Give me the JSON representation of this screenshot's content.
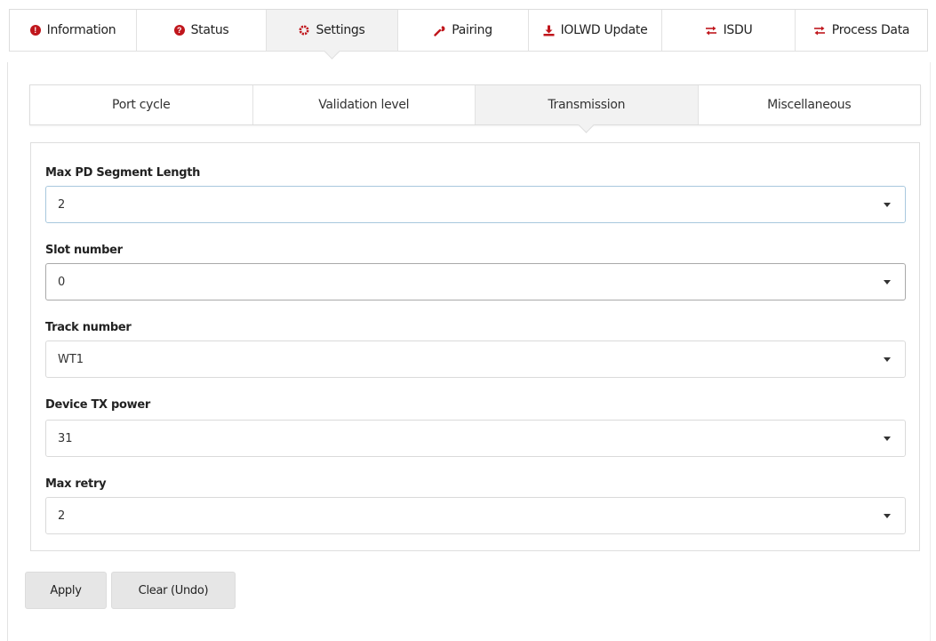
{
  "top_tabs": [
    {
      "label": "Information",
      "icon": "info-circle-icon",
      "active": false
    },
    {
      "label": "Status",
      "icon": "question-circle-icon",
      "active": false
    },
    {
      "label": "Settings",
      "icon": "gear-icon",
      "active": true
    },
    {
      "label": "Pairing",
      "icon": "wrench-icon",
      "active": false
    },
    {
      "label": "IOLWD Update",
      "icon": "download-icon",
      "active": false
    },
    {
      "label": "ISDU",
      "icon": "exchange-icon",
      "active": false
    },
    {
      "label": "Process Data",
      "icon": "exchange-icon",
      "active": false
    }
  ],
  "sub_tabs": [
    {
      "label": "Port cycle",
      "active": false
    },
    {
      "label": "Validation level",
      "active": false
    },
    {
      "label": "Transmission",
      "active": true
    },
    {
      "label": "Miscellaneous",
      "active": false
    }
  ],
  "fields": [
    {
      "label": "Max PD Segment Length",
      "value": "2"
    },
    {
      "label": "Slot number",
      "value": "0"
    },
    {
      "label": "Track number",
      "value": "WT1"
    },
    {
      "label": "Device TX power",
      "value": "31"
    },
    {
      "label": "Max retry",
      "value": "2"
    }
  ],
  "buttons": {
    "apply": "Apply",
    "clear": "Clear (Undo)"
  },
  "colors": {
    "icon_red": "#c0161c",
    "active_tab_bg": "#f2f2f2",
    "button_bg": "#e6e6e6"
  }
}
